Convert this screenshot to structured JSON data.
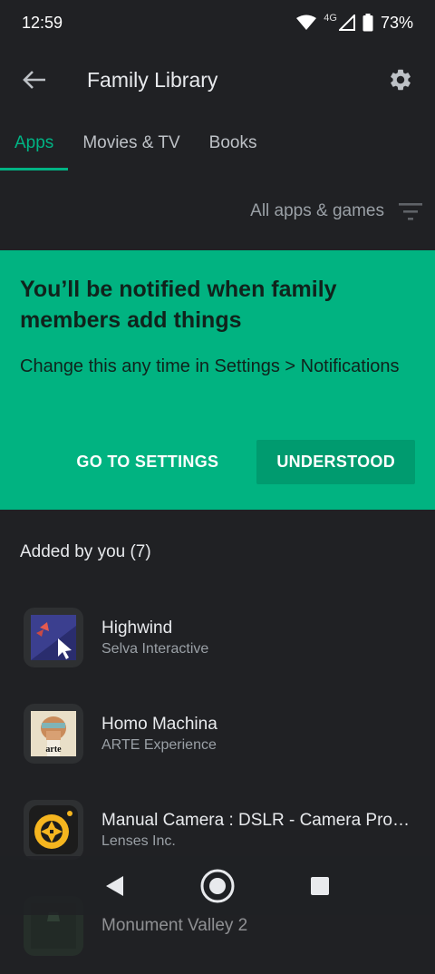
{
  "status": {
    "time": "12:59",
    "network": "4G",
    "battery": "73%"
  },
  "header": {
    "title": "Family Library"
  },
  "tabs": [
    {
      "label": "Apps",
      "active": true
    },
    {
      "label": "Movies & TV",
      "active": false
    },
    {
      "label": "Books",
      "active": false
    }
  ],
  "filter": {
    "label": "All apps & games"
  },
  "banner": {
    "title": "You’ll be notified when family members add things",
    "body": "Change this any time in Settings > Notifications",
    "settings_button": "GO TO SETTINGS",
    "understood_button": "UNDERSTOOD"
  },
  "section": {
    "title": "Added by you (7)"
  },
  "apps": [
    {
      "name": "Highwind",
      "developer": "Selva Interactive",
      "icon": "highwind-icon"
    },
    {
      "name": "Homo Machina",
      "developer": "ARTE Experience",
      "icon": "homo-machina-icon",
      "icon_text": "arte"
    },
    {
      "name": "Manual Camera : DSLR - Camera Professional",
      "developer": "Lenses Inc.",
      "icon": "manual-camera-icon"
    },
    {
      "name": "Monument Valley 2",
      "developer": "",
      "icon": "monument-valley-icon"
    }
  ],
  "colors": {
    "accent": "#00b384",
    "banner": "#01b381",
    "button_filled": "#009b6f",
    "background": "#202124"
  }
}
